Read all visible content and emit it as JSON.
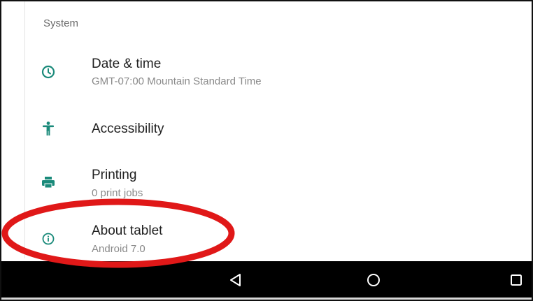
{
  "section": {
    "title": "System"
  },
  "items": [
    {
      "title": "Date & time",
      "summary": "GMT-07:00 Mountain Standard Time",
      "icon": "clock-icon"
    },
    {
      "title": "Accessibility",
      "summary": "",
      "icon": "accessibility-icon"
    },
    {
      "title": "Printing",
      "summary": "0 print jobs",
      "icon": "printer-icon"
    },
    {
      "title": "About tablet",
      "summary": "Android 7.0",
      "icon": "info-icon"
    }
  ],
  "navbar": {
    "buttons": [
      "back-icon",
      "home-icon",
      "recents-icon"
    ]
  },
  "colors": {
    "accent": "#1a8a7a",
    "highlight": "#e01818",
    "navbar": "#000000"
  }
}
